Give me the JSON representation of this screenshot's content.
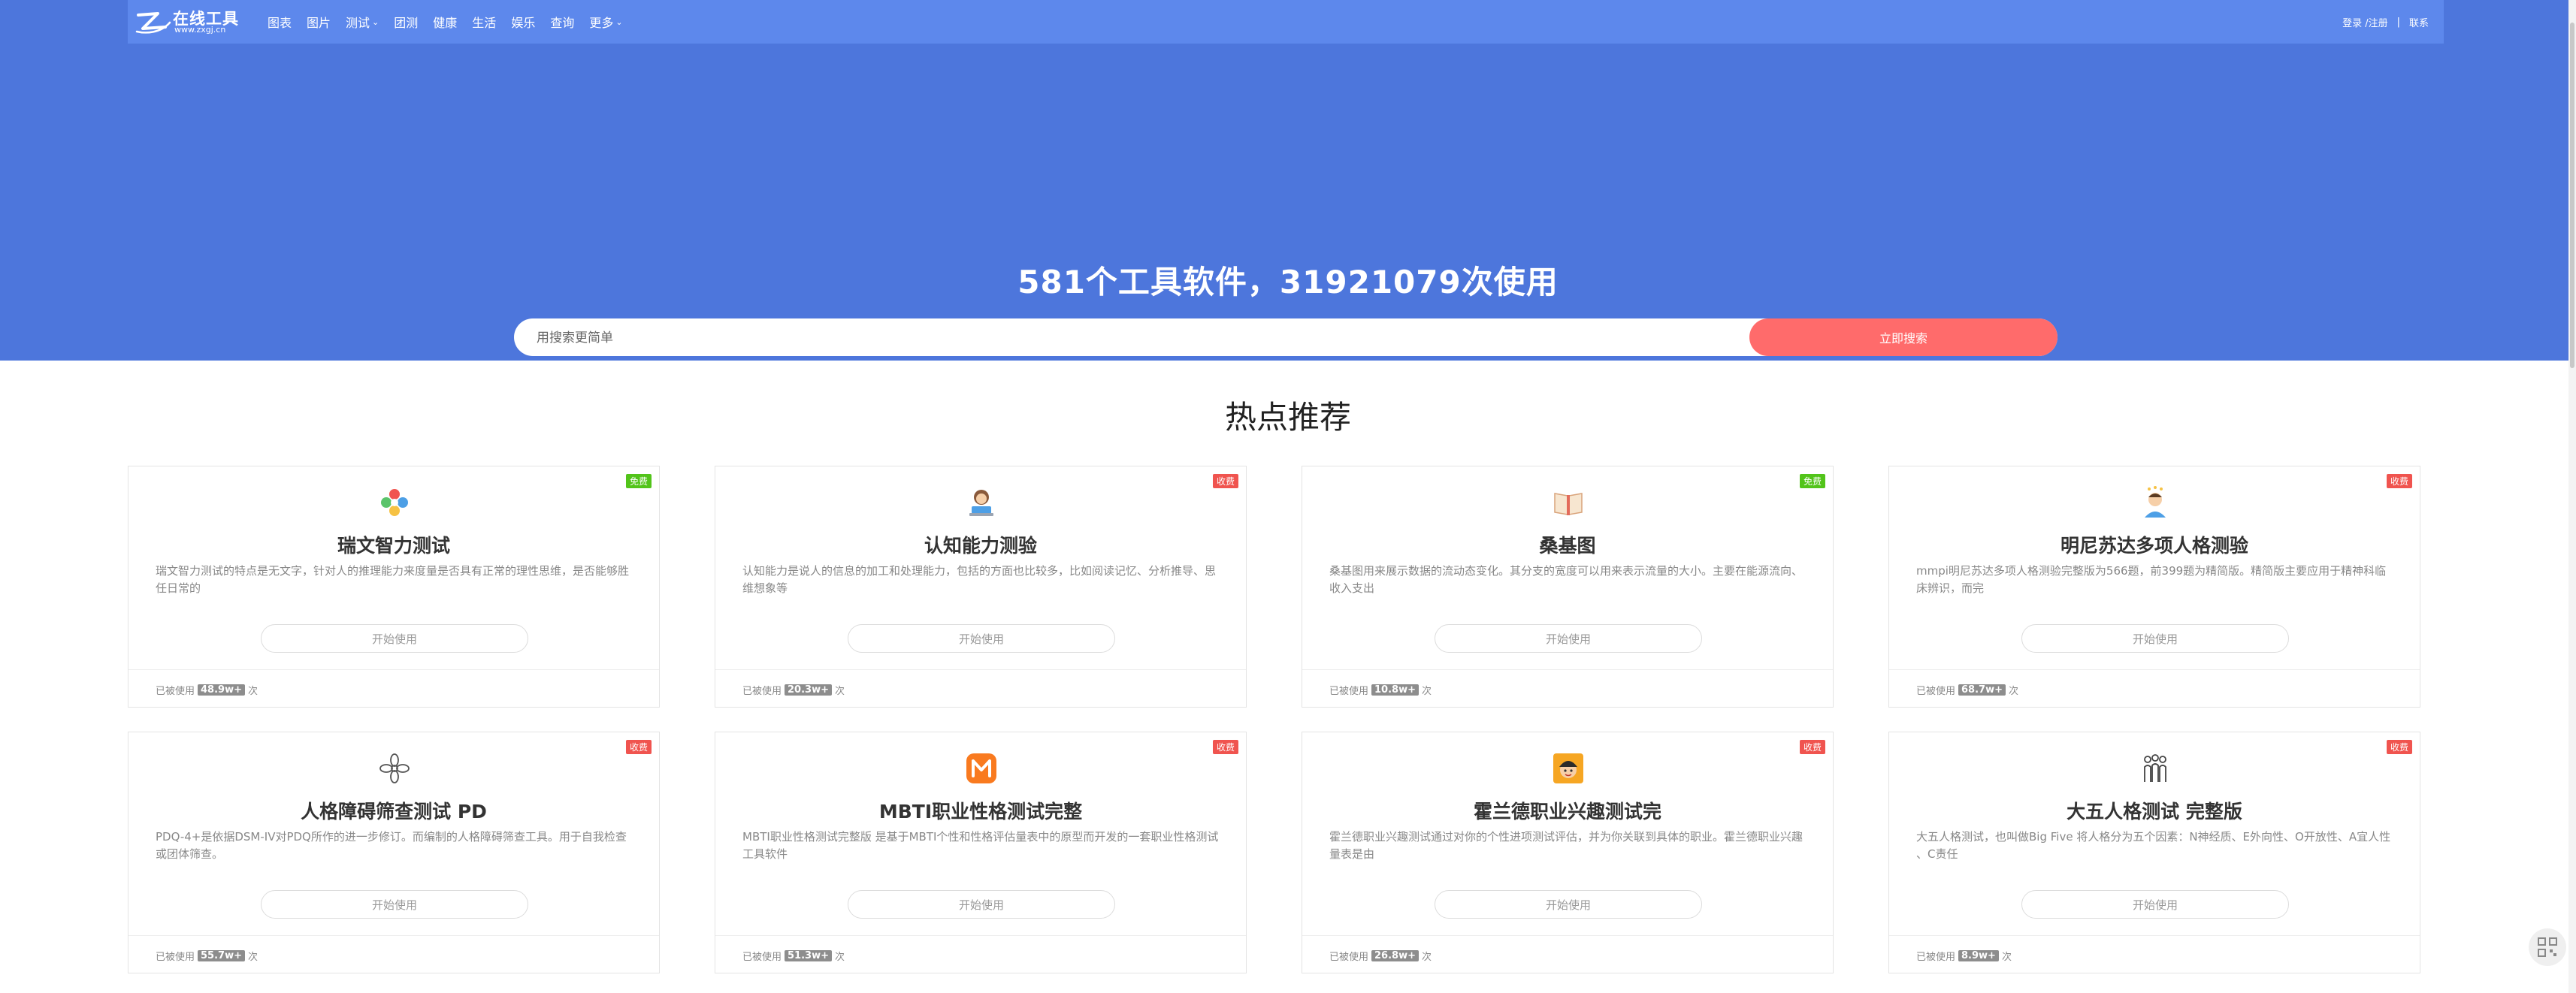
{
  "brand": {
    "name": "在线工具",
    "url": "www.zxgj.cn"
  },
  "nav": [
    {
      "label": "图表"
    },
    {
      "label": "图片"
    },
    {
      "label": "测试",
      "caret": "⌄"
    },
    {
      "label": "团测"
    },
    {
      "label": "健康"
    },
    {
      "label": "生活"
    },
    {
      "label": "娱乐"
    },
    {
      "label": "查询"
    },
    {
      "label": "更多",
      "caret": "⌄"
    }
  ],
  "auth": {
    "login": "登录 /注册",
    "separator": "|",
    "contact": "联系"
  },
  "hero": {
    "headline": "581个工具软件，31921079次使用",
    "search_placeholder": "用搜索更简单",
    "search_button": "立即搜索"
  },
  "section_title": "热点推荐",
  "colors": {
    "hero_bg": "#4d76dc",
    "topbar_bg": "#5d88ec",
    "search_button": "#ff6b6b",
    "badge_free": "#52c41a",
    "badge_paid": "#f0544f"
  },
  "cards": [
    {
      "badge": "免费",
      "badge_type": "free",
      "icon": "puzzle-flower-icon",
      "title": "瑞文智力测试",
      "desc": "瑞文智力测试的特点是无文字，针对人的推理能力来度量是否具有正常的理性思维，是否能够胜任日常的",
      "button": "开始使用",
      "usage_prefix": "已被使用",
      "usage_count": "48.9w+",
      "usage_suffix": "次"
    },
    {
      "badge": "收费",
      "badge_type": "paid",
      "icon": "girl-with-laptop-icon",
      "title": "认知能力测验",
      "desc": "认知能力是说人的信息的加工和处理能力，包括的方面也比较多，比如阅读记忆、分析推导、思维想象等",
      "button": "开始使用",
      "usage_prefix": "已被使用",
      "usage_count": "20.3w+",
      "usage_suffix": "次"
    },
    {
      "badge": "免费",
      "badge_type": "free",
      "icon": "open-book-icon",
      "title": "桑基图",
      "desc": "桑基图用来展示数据的流动态变化。其分支的宽度可以用来表示流量的大小。主要在能源流向、收入支出",
      "button": "开始使用",
      "usage_prefix": "已被使用",
      "usage_count": "10.8w+",
      "usage_suffix": "次"
    },
    {
      "badge": "收费",
      "badge_type": "paid",
      "icon": "thinking-person-icon",
      "title": "明尼苏达多项人格测验",
      "desc": "mmpi明尼苏达多项人格测验完整版为566题，前399题为精简版。精简版主要应用于精神科临床辨识，而完",
      "button": "开始使用",
      "usage_prefix": "已被使用",
      "usage_count": "68.7w+",
      "usage_suffix": "次"
    },
    {
      "badge": "收费",
      "badge_type": "paid",
      "icon": "flower-outline-icon",
      "title": "人格障碍筛查测试 PD",
      "desc": "PDQ-4+是依据DSM-IV对PDQ所作的进一步修订。而编制的人格障碍筛查工具。用于自我检查或团体筛查。",
      "button": "开始使用",
      "usage_prefix": "已被使用",
      "usage_count": "55.7w+",
      "usage_suffix": "次"
    },
    {
      "badge": "收费",
      "badge_type": "paid",
      "icon": "letter-m-icon",
      "title": "MBTI职业性格测试完整",
      "desc": "MBTI职业性格测试完整版 是基于MBTI个性和性格评估量表中的原型而开发的一套职业性格测试工具软件",
      "button": "开始使用",
      "usage_prefix": "已被使用",
      "usage_count": "51.3w+",
      "usage_suffix": "次"
    },
    {
      "badge": "收费",
      "badge_type": "paid",
      "icon": "boy-avatar-icon",
      "title": "霍兰德职业兴趣测试完",
      "desc": "霍兰德职业兴趣测试通过对你的个性进项测试评估，并为你关联到具体的职业。霍兰德职业兴趣量表是由",
      "button": "开始使用",
      "usage_prefix": "已被使用",
      "usage_count": "26.8w+",
      "usage_suffix": "次"
    },
    {
      "badge": "收费",
      "badge_type": "paid",
      "icon": "people-group-icon",
      "title": "大五人格测试 完整版",
      "desc": "大五人格测试，也叫做Big Five 将人格分为五个因素：N神经质、E外向性、O开放性、A宜人性 、C责任",
      "button": "开始使用",
      "usage_prefix": "已被使用",
      "usage_count": "8.9w+",
      "usage_suffix": "次"
    }
  ]
}
